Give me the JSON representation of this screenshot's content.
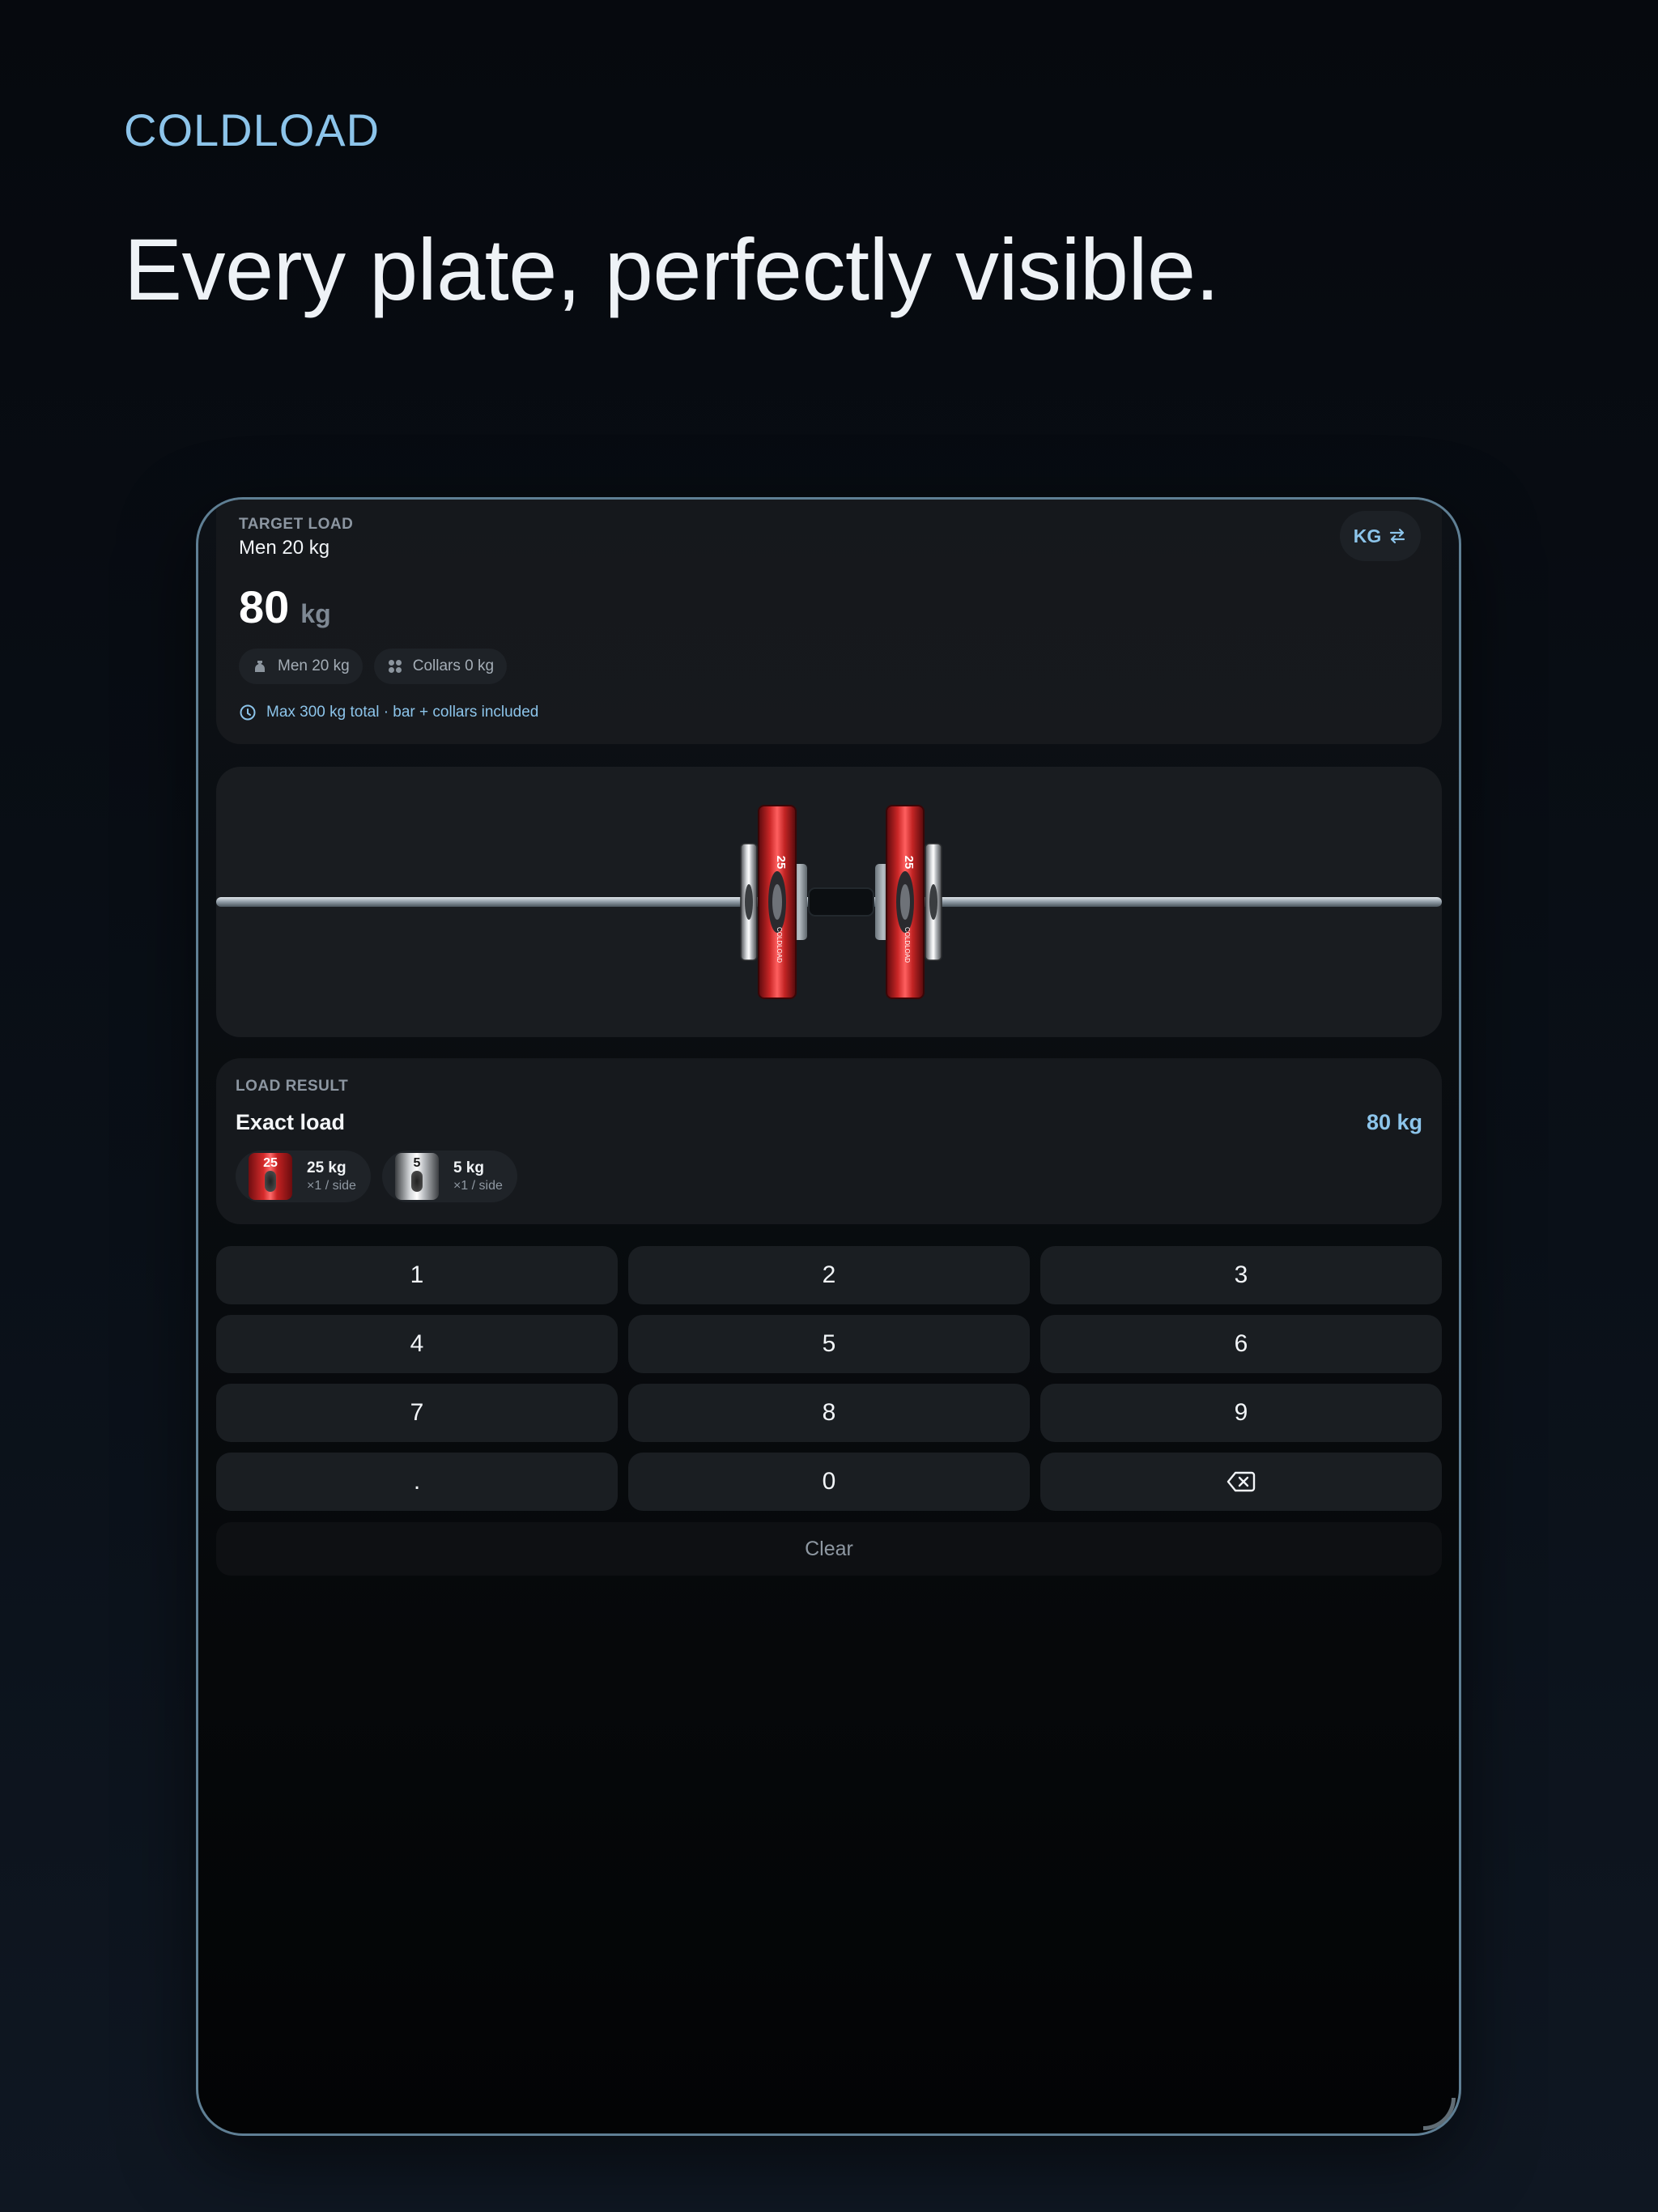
{
  "brand": "COLDLOAD",
  "headline": "Every plate, perfectly visible.",
  "colors": {
    "accent": "#8cc4ea",
    "plate_red": "#d62b2b",
    "plate_silver": "#d8dbde"
  },
  "target": {
    "caption": "TARGET LOAD",
    "bar_name": "Men 20 kg",
    "value": "80",
    "unit": "kg",
    "unit_toggle": "KG",
    "chips": [
      {
        "icon": "kettlebell-icon",
        "label": "Men 20 kg"
      },
      {
        "icon": "grid-dots-icon",
        "label": "Collars 0 kg"
      }
    ],
    "note": "Max 300 kg total · bar + collars included"
  },
  "barbell": {
    "plate_label_25": "25",
    "brand_mark": "COLDLOAD"
  },
  "result": {
    "caption": "LOAD RESULT",
    "title": "Exact load",
    "total": "80 kg",
    "plates": [
      {
        "thumb": "25",
        "weight": "25 kg",
        "count": "×1 / side",
        "color": "red"
      },
      {
        "thumb": "5",
        "weight": "5 kg",
        "count": "×1 / side",
        "color": "silver"
      }
    ]
  },
  "keypad": {
    "keys": [
      "1",
      "2",
      "3",
      "4",
      "5",
      "6",
      "7",
      "8",
      "9",
      ".",
      "0"
    ],
    "backspace_icon": "backspace-icon",
    "clear": "Clear"
  }
}
